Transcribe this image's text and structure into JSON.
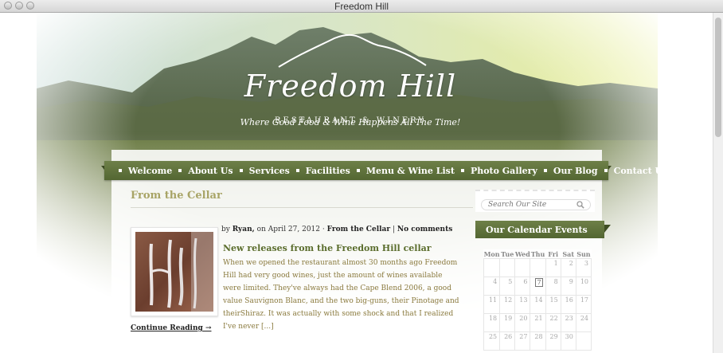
{
  "window": {
    "title": "Freedom Hill"
  },
  "site": {
    "logo_name": "Freedom Hill",
    "logo_sub": "RESTAURANT & WINERY",
    "tagline": "Where Good Food & Wine Happens All The Time!"
  },
  "nav": {
    "items": [
      "Welcome",
      "About Us",
      "Services",
      "Facilities",
      "Menu & Wine List",
      "Photo Gallery",
      "Our Blog",
      "Contact Us"
    ]
  },
  "main": {
    "section_title": "From the Cellar",
    "post": {
      "by_prefix": "by",
      "author": "Ryan,",
      "date_text": "on April 27, 2012 ·",
      "category": "From the Cellar",
      "separator": "|",
      "comments": "No comments",
      "title": "New releases from the Freedom Hill cellar",
      "excerpt": "When we opened the restaurant almost 30 months ago Freedom Hill had very good wines, just the amount of wines available were limited. They've always had the Cape Blend 2006, a good value Sauvignon Blanc, and the two big-guns, their Pinotage and theirShiraz. It was actually with some shock and that I realized I've never [...]",
      "continue_label": "Continue Reading →"
    }
  },
  "sidebar": {
    "search_placeholder": "Search Our Site",
    "calendar_title": "Our Calendar Events",
    "calendar": {
      "days": [
        "Mon",
        "Tue",
        "Wed",
        "Thu",
        "Fri",
        "Sat",
        "Sun"
      ],
      "weeks": [
        [
          "",
          "",
          "",
          "",
          "1",
          "2",
          "3"
        ],
        [
          "4",
          "5",
          "6",
          "7",
          "8",
          "9",
          "10"
        ],
        [
          "11",
          "12",
          "13",
          "14",
          "15",
          "16",
          "17"
        ],
        [
          "18",
          "19",
          "20",
          "21",
          "22",
          "23",
          "24"
        ],
        [
          "25",
          "26",
          "27",
          "28",
          "29",
          "30",
          ""
        ]
      ],
      "today": "7"
    }
  },
  "colors": {
    "accent_green": "#5b6d2d",
    "title_olive": "#a8a466",
    "excerpt_brown": "#8a7a3e"
  }
}
